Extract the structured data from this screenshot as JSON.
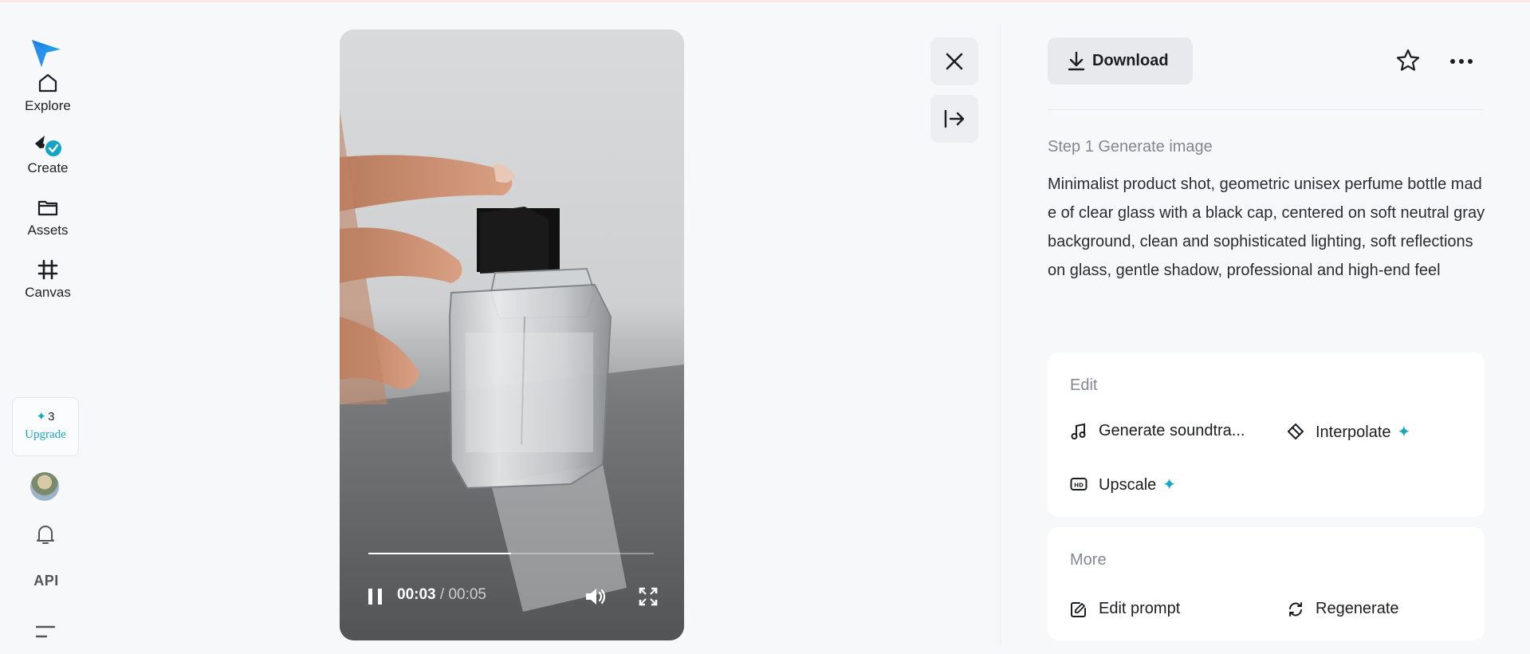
{
  "sidebar": {
    "items": [
      {
        "label": "Explore",
        "icon": "home-icon"
      },
      {
        "label": "Create",
        "icon": "create-icon"
      },
      {
        "label": "Assets",
        "icon": "folder-icon"
      },
      {
        "label": "Canvas",
        "icon": "canvas-grid-icon"
      }
    ],
    "credits": "3",
    "upgrade_label": "Upgrade",
    "api_label": "API"
  },
  "video": {
    "current_time": "00:03",
    "separator": " / ",
    "duration": "00:05",
    "progress_fraction": 0.5
  },
  "panel": {
    "download_label": "Download",
    "step_title": "Step 1 Generate image",
    "prompt": "Minimalist product shot, geometric unisex perfume bottle made of clear glass with a black cap, centered on soft neutral gray background, clean and sophisticated lighting, soft reflections on glass, gentle shadow, professional and high-end feel",
    "edit": {
      "title": "Edit",
      "actions": [
        {
          "label": "Generate soundtra...",
          "icon": "music-note-icon",
          "premium": false
        },
        {
          "label": "Interpolate",
          "icon": "interpolate-icon",
          "premium": true
        },
        {
          "label": "Upscale",
          "icon": "hd-icon",
          "premium": true
        }
      ]
    },
    "more": {
      "title": "More",
      "actions": [
        {
          "label": "Edit prompt",
          "icon": "edit-prompt-icon"
        },
        {
          "label": "Regenerate",
          "icon": "regenerate-icon"
        }
      ]
    }
  },
  "colors": {
    "accent": "#15a6c2",
    "background": "#f7f8fa",
    "button_bg": "#e7e9ec"
  }
}
